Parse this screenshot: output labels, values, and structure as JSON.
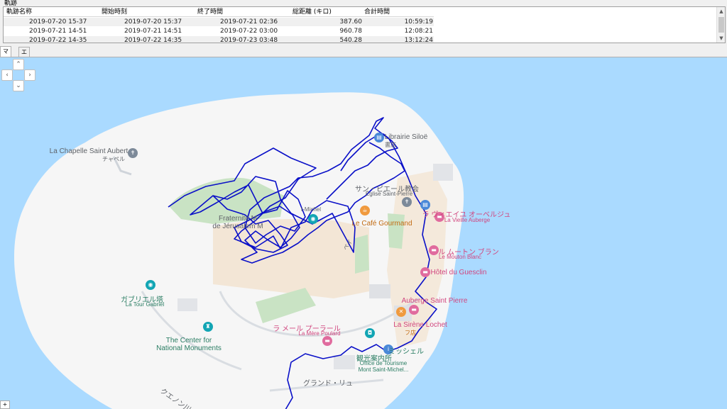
{
  "group_title": "軌跡",
  "table": {
    "headers": [
      "軌跡名称",
      "開始時刻",
      "終了時間",
      "総距離 (キロ)",
      "合計時間"
    ],
    "rows": [
      [
        "2019-07-20 15-37",
        "2019-07-20 15:37",
        "2019-07-21 02:36",
        "387.60",
        "10:59:19"
      ],
      [
        "2019-07-21 14-51",
        "2019-07-21 14:51",
        "2019-07-22 03:00",
        "960.78",
        "12:08:21"
      ],
      [
        "2019-07-22 14-35",
        "2019-07-22 14:35",
        "2019-07-23 03:48",
        "540.28",
        "13:12:24"
      ]
    ]
  },
  "tabs": [
    "マップ",
    "エディタ"
  ],
  "map": {
    "nav": {
      "up": "⌃",
      "left": "‹",
      "right": "›",
      "down": "⌄"
    },
    "labels": {
      "chapelle": "La Chapelle Saint Aubert",
      "chapelle_ja": "チャペル",
      "librairie": "Librairie Siloë",
      "librairie_ja": "書店",
      "eglise_ja": "サン・ピエール教会",
      "eglise": "Église Saint-Pierre",
      "fraternite": "Fraternité M",
      "jerusalem": "de Jérusalem M",
      "michel": "t-Michel",
      "cafe": "Le Café Gourmand",
      "vieille_ja": "ラ ヴィエイユ オーベルジュ",
      "vieille": "La Vieille Auberge",
      "mouton_ja": "ル ムートン ブラン",
      "mouton": "Le Mouton Blanc",
      "guesclin": "Hôtel du Guesclin",
      "gabriel_ja": "ガブリエル塔",
      "gabriel": "La Tour Gabriel",
      "auberge": "Auberge Saint Pierre",
      "sirene": "La Sirène Lochet",
      "sirene_sub": "フ店",
      "poulard_ja": "ラ メール プーラール",
      "poulard": "La Mère Poulard",
      "monuments": "The Center for National Monuments",
      "office_ja": "観光案内所",
      "michel_ja": "ミッシェル",
      "office": "Office de Tourisme Mont Saint-Michel...",
      "grande_rue": "グランド・リュ",
      "road_ja": "クエノン川",
      "lane_ja": "ペイ"
    }
  }
}
